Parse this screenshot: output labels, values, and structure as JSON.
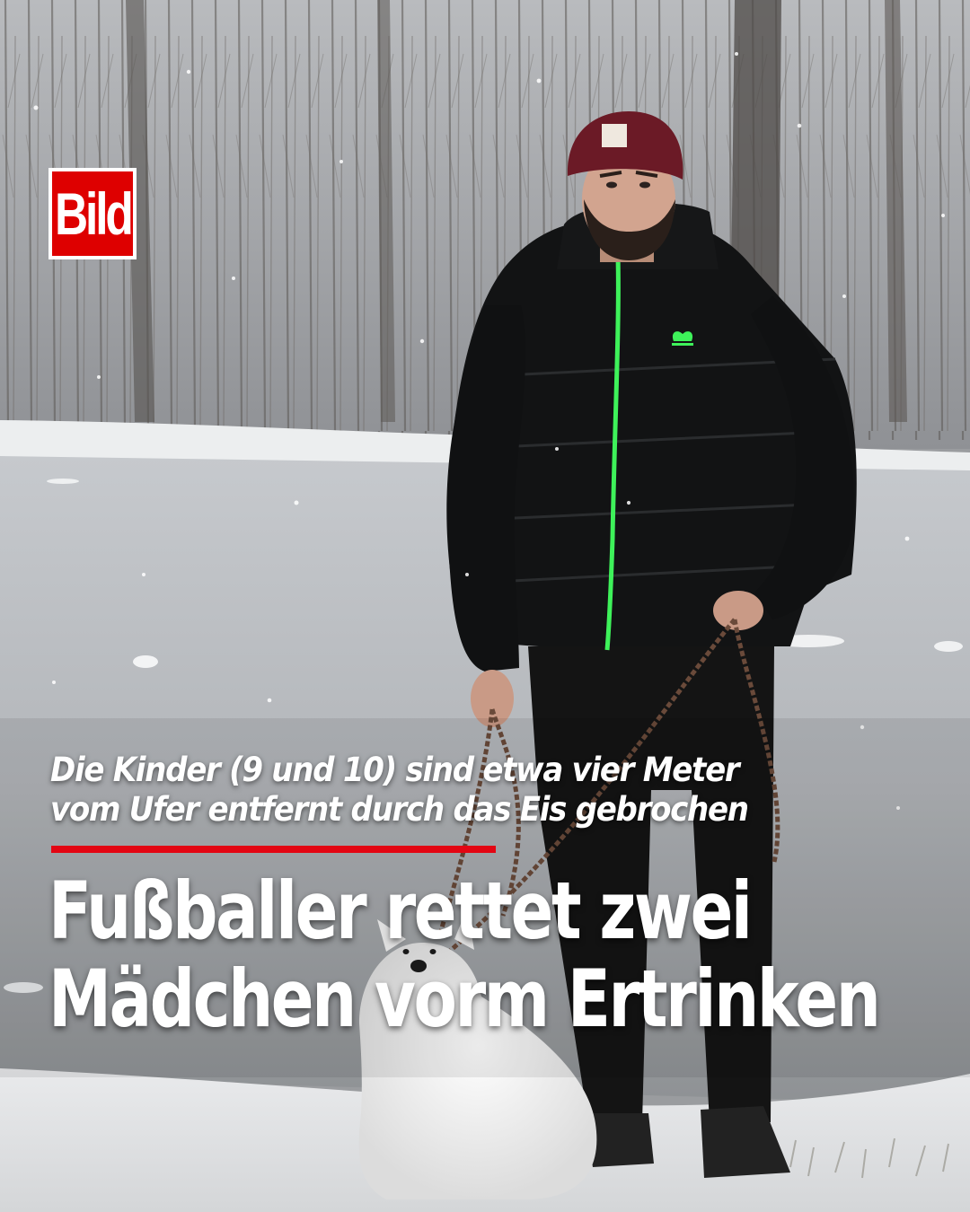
{
  "brand": {
    "logo_text": "Bild",
    "logo_red": "#de0000"
  },
  "post": {
    "subtitle_lines": [
      "Die Kinder (9 und 10) sind etwa vier Meter",
      "vom Ufer entfernt durch das Eis gebrochen"
    ],
    "headline_lines": [
      "Fußballer rettet zwei",
      "Mädchen vorm Ertrinken"
    ],
    "rule_color": "#e30613"
  },
  "photo": {
    "subject": "man-in-black-puffer-jacket-with-white-dog",
    "jacket_zip_color": "#3ef25a",
    "beanie_color": "#6b1a26"
  }
}
